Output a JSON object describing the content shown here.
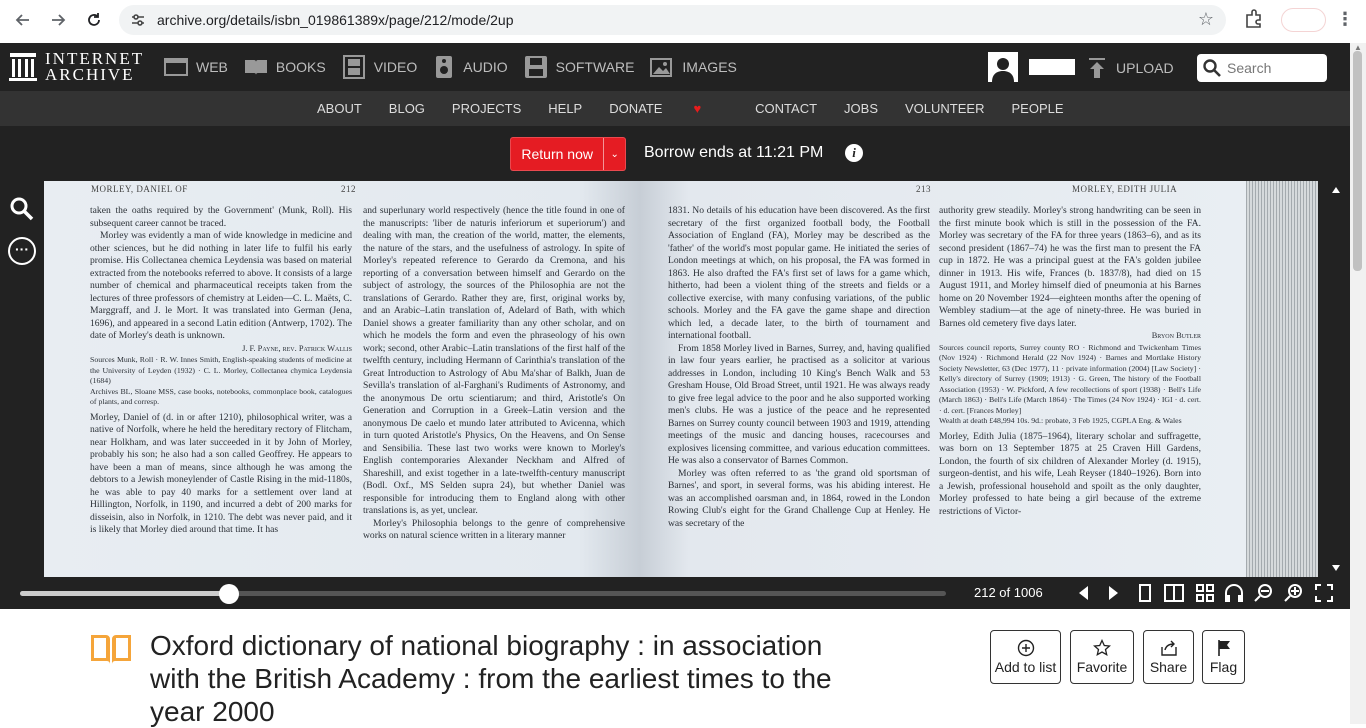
{
  "browser": {
    "url": "archive.org/details/isbn_019861389x/page/212/mode/2up"
  },
  "ia_nav": {
    "logo_line1": "INTERNET",
    "logo_line2": "ARCHIVE",
    "media": [
      {
        "label": "WEB",
        "icon": "web-icon"
      },
      {
        "label": "BOOKS",
        "icon": "books-icon"
      },
      {
        "label": "VIDEO",
        "icon": "video-icon"
      },
      {
        "label": "AUDIO",
        "icon": "audio-icon"
      },
      {
        "label": "SOFTWARE",
        "icon": "software-icon"
      },
      {
        "label": "IMAGES",
        "icon": "images-icon"
      }
    ],
    "upload_label": "UPLOAD",
    "search_placeholder": "Search"
  },
  "sub_nav": [
    "ABOUT",
    "BLOG",
    "PROJECTS",
    "HELP",
    "DONATE",
    "CONTACT",
    "JOBS",
    "VOLUNTEER",
    "PEOPLE"
  ],
  "borrow": {
    "return_label": "Return now",
    "borrow_text": "Borrow ends at 11:21 PM",
    "info_glyph": "i"
  },
  "book": {
    "left_header_name": "MORLEY, DANIEL OF",
    "left_page_number": "212",
    "right_page_number": "213",
    "right_header_name": "MORLEY, EDITH JULIA",
    "left_col1": [
      "taken the oaths required by the Government' (Munk, Roll). His subsequent career cannot be traced.",
      "Morley was evidently a man of wide knowledge in medicine and other sciences, but he did nothing in later life to fulfil his early promise. His Collectanea chemica Leydensia was based on material extracted from the notebooks referred to above. It consists of a large number of chemical and pharmaceutical receipts taken from the lectures of three professors of chemistry at Leiden—C. L. Maëts, C. Marggraff, and J. le Mort. It was translated into German (Jena, 1696), and appeared in a second Latin edition (Antwerp, 1702). The date of Morley's death is unknown."
    ],
    "left_col1_sig": "J. F. Payne, rev. Patrick Wallis",
    "left_col1_sources": "Sources Munk, Roll · R. W. Innes Smith, English-speaking students of medicine at the University of Leyden (1932) · C. L. Morley, Collectanea chymica Leydensia (1684)",
    "left_col1_archives": "Archives BL, Sloane MSS, case books, notebooks, commonplace book, catalogues of plants, and corresp.",
    "left_col1_entry": "Morley, Daniel of (d. in or after 1210), philosophical writer, was a native of Norfolk, where he held the hereditary rectory of Flitcham, near Holkham, and was later succeeded in it by John of Morley, probably his son; he also had a son called Geoffrey. He appears to have been a man of means, since although he was among the debtors to a Jewish moneylender of Castle Rising in the mid-1180s, he was able to pay 40 marks for a settlement over land at Hillington, Norfolk, in 1190, and incurred a debt of 200 marks for disseisin, also in Norfolk, in 1210. The debt was never paid, and it is likely that Morley died around that time. It has",
    "left_col2": [
      "and superlunary world respectively (hence the title found in one of the manuscripts: 'liber de naturis inferiorum et superiorum') and dealing with man, the creation of the world, matter, the elements, the nature of the stars, and the usefulness of astrology. In spite of Morley's repeated reference to Gerardo da Cremona, and his reporting of a conversation between himself and Gerardo on the subject of astrology, the sources of the Philosophia are not the translations of Gerardo. Rather they are, first, original works by, and an Arabic–Latin translation of, Adelard of Bath, with which Daniel shows a greater familiarity than any other scholar, and on which he models the form and even the phraseology of his own work; second, other Arabic–Latin translations of the first half of the twelfth century, including Hermann of Carinthia's translation of the Great Introduction to Astrology of Abu Ma'shar of Balkh, Juan de Sevilla's translation of al-Farghani's Rudiments of Astronomy, and the anonymous De ortu scientiarum; and third, Aristotle's On Generation and Corruption in a Greek–Latin version and the anonymous De caelo et mundo later attributed to Avicenna, which in turn quoted Aristotle's Physics, On the Heavens, and On Sense and Sensibilia. These last two works were known to Morley's English contemporaries Alexander Neckham and Alfred of Shareshill, and exist together in a late-twelfth-century manuscript (Bodl. Oxf., MS Selden supra 24), but whether Daniel was responsible for introducing them to England along with other translations is, as yet, unclear.",
      "Morley's Philosophia belongs to the genre of comprehensive works on natural science written in a literary manner"
    ],
    "right_col1": [
      "1831. No details of his education have been discovered. As the first secretary of the first organized football body, the Football Association of England (FA), Morley may be described as the 'father' of the world's most popular game. He initiated the series of London meetings at which, on his proposal, the FA was formed in 1863. He also drafted the FA's first set of laws for a game which, hitherto, had been a violent thing of the streets and fields or a collective exercise, with many confusing variations, of the public schools. Morley and the FA gave the game shape and direction which led, a decade later, to the birth of tournament and international football.",
      "From 1858 Morley lived in Barnes, Surrey, and, having qualified in law four years earlier, he practised as a solicitor at various addresses in London, including 10 King's Bench Walk and 53 Gresham House, Old Broad Street, until 1921. He was always ready to give free legal advice to the poor and he also supported working men's clubs. He was a justice of the peace and he represented Barnes on Surrey county council between 1903 and 1919, attending meetings of the music and dancing houses, racecourses and explosives licensing committee, and various education committees. He was also a conservator of Barnes Common.",
      "Morley was often referred to as 'the grand old sportsman of Barnes', and sport, in several forms, was his abiding interest. He was an accomplished oarsman and, in 1864, rowed in the London Rowing Club's eight for the Grand Challenge Cup at Henley. He was secretary of the"
    ],
    "right_col2": [
      "authority grew steadily. Morley's strong handwriting can be seen in the first minute book which is still in the possession of the FA. Morley was secretary of the FA for three years (1863–6), and as its second president (1867–74) he was the first man to present the FA cup in 1872. He was a principal guest at the FA's golden jubilee dinner in 1913. His wife, Frances (b. 1837/8), had died on 15 August 1911, and Morley himself died of pneumonia at his Barnes home on 20 November 1924—eighteen months after the opening of Wembley stadium—at the age of ninety-three. He was buried in Barnes old cemetery five days later."
    ],
    "right_col2_sig": "Bryon Butler",
    "right_col2_sources": "Sources council reports, Surrey county RO · Richmond and Twickenham Times (Nov 1924) · Richmond Herald (22 Nov 1924) · Barnes and Mortlake History Society Newsletter, 63 (Dec 1977), 11 · private information (2004) [Law Society] · Kelly's directory of Surrey (1909; 1913) · G. Green, The history of the Football Association (1953) · W. Pickford, A few recollections of sport (1938) · Bell's Life (March 1863) · Bell's Life (March 1864) · The Times (24 Nov 1924) · IGI · d. cert. · d. cert. [Frances Morley]",
    "right_col2_wealth": "Wealth at death £48,994 10s. 9d.: probate, 3 Feb 1925, CGPLA Eng. & Wales",
    "right_col2_entry": "Morley, Edith Julia (1875–1964), literary scholar and suffragette, was born on 13 September 1875 at 25 Craven Hill Gardens, London, the fourth of six children of Alexander Morley (d. 1915), surgeon-dentist, and his wife, Leah Reyser (1840–1926). Born into a Jewish, professional household and spoilt as the only daughter, Morley professed to hate being a girl because of the extreme restrictions of Victor-"
  },
  "viewer": {
    "page_count": "212 of 1006",
    "progress_fraction": 0.226
  },
  "item": {
    "title": "Oxford dictionary of national biography : in association with the British Academy : from the earliest times to the year 2000",
    "actions": [
      {
        "label": "Add to list",
        "icon": "add-icon"
      },
      {
        "label": "Favorite",
        "icon": "star-icon"
      },
      {
        "label": "Share",
        "icon": "share-icon"
      },
      {
        "label": "Flag",
        "icon": "flag-icon"
      }
    ]
  },
  "colors": {
    "return_button": "#e51c23",
    "ia_dark": "#222222",
    "book_icon": "#f5a53a"
  }
}
